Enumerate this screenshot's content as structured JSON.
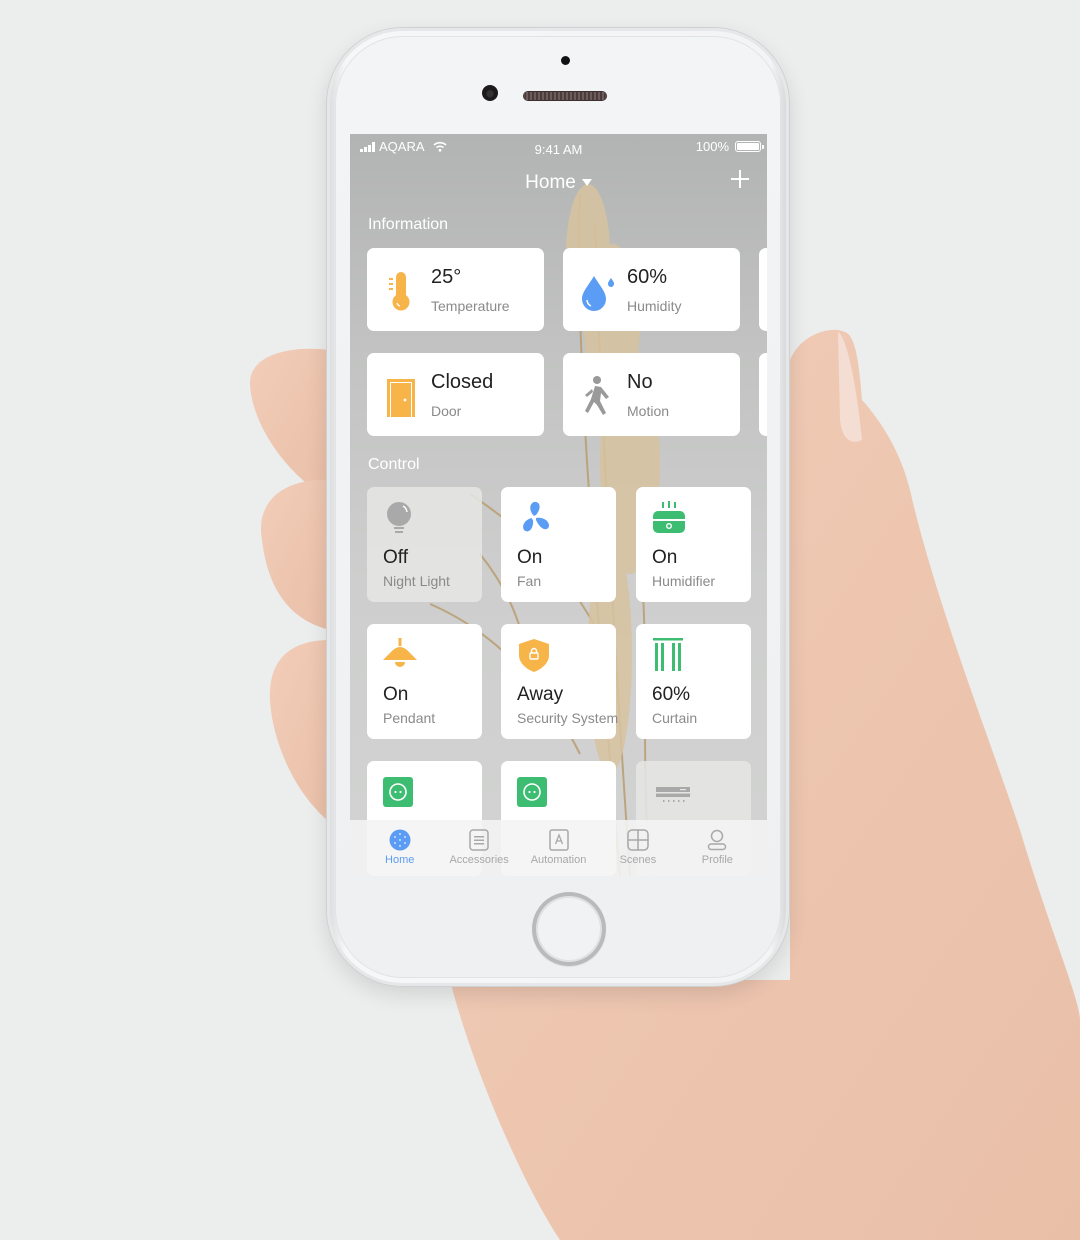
{
  "status_bar": {
    "carrier": "AQARA",
    "time": "9:41 AM",
    "battery_percent": "100%"
  },
  "header": {
    "title": "Home",
    "add_icon": "plus-icon"
  },
  "information": {
    "section_label": "Information",
    "cards": [
      {
        "value": "25°",
        "label": "Temperature",
        "icon": "thermometer-icon",
        "color": "#f6b449"
      },
      {
        "value": "60%",
        "label": "Humidity",
        "icon": "water-drop-icon",
        "color": "#5b9cf4"
      },
      {
        "value": "Closed",
        "label": "Door",
        "icon": "door-icon",
        "color": "#f6b449"
      },
      {
        "value": "No",
        "label": "Motion",
        "icon": "walking-person-icon",
        "color": "#9a9a9a"
      }
    ]
  },
  "control": {
    "section_label": "Control",
    "cards": [
      {
        "value": "Off",
        "label": "Night Light",
        "icon": "lightbulb-icon",
        "state": "off",
        "color": "#a9a9a9"
      },
      {
        "value": "On",
        "label": "Fan",
        "icon": "fan-icon",
        "state": "on",
        "color": "#5b9cf4"
      },
      {
        "value": "On",
        "label": "Humidifier",
        "icon": "humidifier-icon",
        "state": "on",
        "color": "#3dbd72"
      },
      {
        "value": "On",
        "label": "Pendant",
        "icon": "pendant-lamp-icon",
        "state": "on",
        "color": "#f6b449"
      },
      {
        "value": "Away",
        "label": "Security System",
        "icon": "shield-lock-icon",
        "state": "on",
        "color": "#f6b449"
      },
      {
        "value": "60%",
        "label": "Curtain",
        "icon": "curtain-icon",
        "state": "on",
        "color": "#3dbd72"
      },
      {
        "value": "",
        "label": "",
        "icon": "wall-outlet-icon",
        "state": "on",
        "color": "#3dbd72"
      },
      {
        "value": "",
        "label": "",
        "icon": "wall-outlet-icon",
        "state": "on",
        "color": "#3dbd72"
      },
      {
        "value": "",
        "label": "",
        "icon": "air-conditioner-icon",
        "state": "off",
        "color": "#a9a9a9"
      }
    ]
  },
  "tab_bar": {
    "active": "Home",
    "active_color": "#5b9cf4",
    "tabs": [
      {
        "label": "Home",
        "icon": "home-dots-icon"
      },
      {
        "label": "Accessories",
        "icon": "list-icon"
      },
      {
        "label": "Automation",
        "icon": "automation-a-icon"
      },
      {
        "label": "Scenes",
        "icon": "scenes-grid-icon"
      },
      {
        "label": "Profile",
        "icon": "profile-icon"
      }
    ]
  }
}
